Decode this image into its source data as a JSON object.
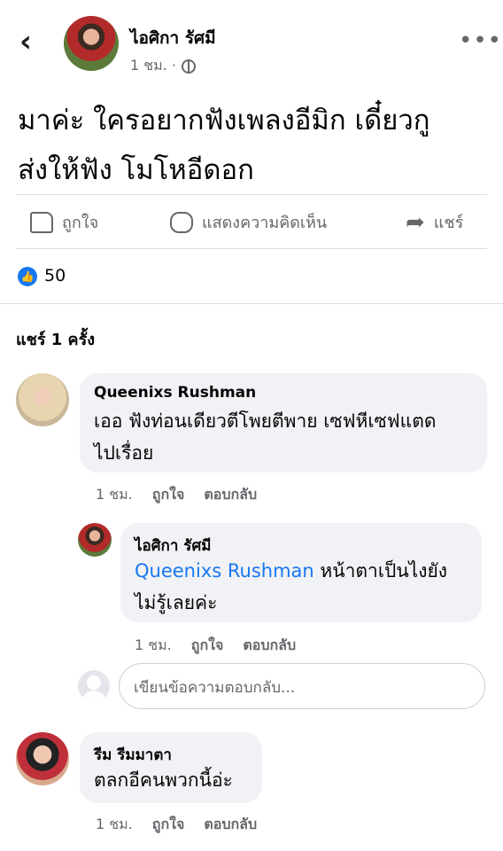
{
  "header": {
    "back_icon": "chevron-left-icon",
    "author_name": "ไอศิกา รัศมี",
    "time": "1 ชม. ·",
    "privacy_icon": "globe-icon",
    "more_icon": "more-dots-icon",
    "more_glyph": "•••"
  },
  "post": {
    "line1": "มาค่ะ ใครอยากฟังเพลงอีมิก เดี๋ยวกู",
    "line2": "ส่งให้ฟัง โมโหอีดอก"
  },
  "actions": {
    "like_label": "ถูกใจ",
    "comment_label": "แสดงความคิดเห็น",
    "share_label": "แชร์"
  },
  "reactions": {
    "count": "50",
    "icon": "like-reaction-icon"
  },
  "shares_text": "แชร์ 1 ครั้ง",
  "comments": [
    {
      "name": "Queenixs Rushman",
      "line1": "เออ ฟังท่อนเดียวตีโพยตีพาย เซฟหีเซฟแตด",
      "line2": "ไปเรื่อย",
      "time": "1 ชม.",
      "like": "ถูกใจ",
      "reply": "ตอบกลับ"
    },
    {
      "name": "ไอศิกา รัศมี",
      "tag": "Queenixs Rushman",
      "line1_rest": " หน้าตาเป็นไงยัง",
      "line2": "ไม่รู้เลยค่ะ",
      "time": "1 ชม.",
      "like": "ถูกใจ",
      "reply": "ตอบกลับ"
    },
    {
      "name": "รีม รีมมาตา",
      "line1": "ตลกอีคนพวกนี้อ่ะ",
      "time": "1 ชม.",
      "like": "ถูกใจ",
      "reply": "ตอบกลับ"
    }
  ],
  "reply_input": {
    "placeholder": "เขียนข้อความตอบกลับ..."
  },
  "colors": {
    "accent": "#1877f2",
    "muted": "#65676b",
    "bubble": "#f0f2f5"
  }
}
